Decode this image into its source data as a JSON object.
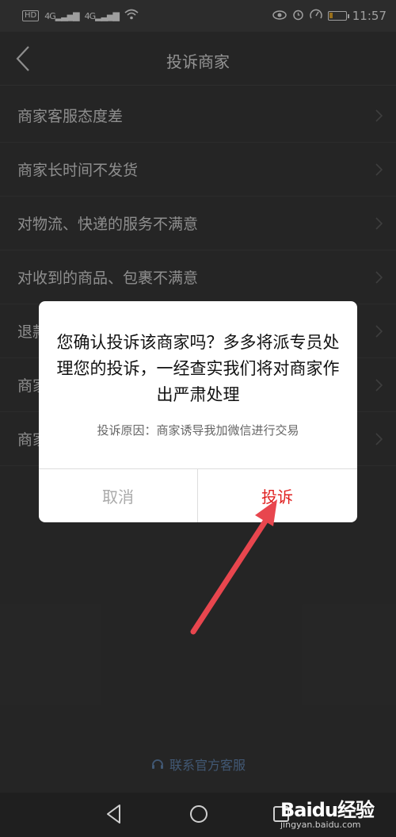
{
  "status_bar": {
    "badge": "HD",
    "signal1": "4G",
    "signal2": "4G",
    "time": "11:57",
    "battery_level": 0.2
  },
  "header": {
    "title": "投诉商家"
  },
  "list": {
    "items": [
      {
        "label": "商家客服态度差"
      },
      {
        "label": "商家长时间不发货"
      },
      {
        "label": "对物流、快递的服务不满意"
      },
      {
        "label": "对收到的商品、包裹不满意"
      },
      {
        "label": "退款"
      },
      {
        "label": "商家"
      },
      {
        "label": "商家"
      }
    ]
  },
  "dialog": {
    "message": "您确认投诉该商家吗？多多将派专员处理您的投诉，一经查实我们将对商家作出严肃处理",
    "reason": "投诉原因：商家诱导我加微信进行交易",
    "cancel_label": "取消",
    "confirm_label": "投诉"
  },
  "contact": {
    "label": "联系官方客服"
  },
  "watermark": {
    "logo": "Baidu经验",
    "sub": "jingyan.baidu.com"
  },
  "colors": {
    "accent": "#e02020",
    "arrow": "#e8464e",
    "link": "#5a7da8"
  },
  "icons": {
    "back": "chevron-left-icon",
    "chevron": "chevron-right-icon",
    "contact": "headset-icon"
  }
}
